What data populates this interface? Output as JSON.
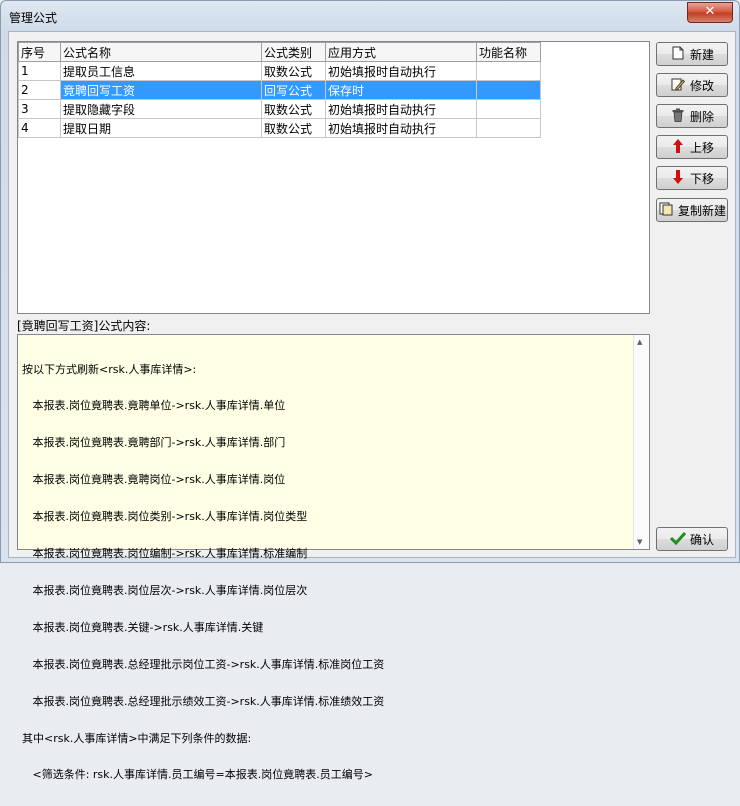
{
  "window": {
    "title": "管理公式",
    "close_label": "✕"
  },
  "grid": {
    "headers": [
      "序号",
      "公式名称",
      "公式类别",
      "应用方式",
      "功能名称"
    ],
    "rows": [
      [
        "1",
        "提取员工信息",
        "取数公式",
        "初始填报时自动执行",
        ""
      ],
      [
        "2",
        "竟聘回写工资",
        "回写公式",
        "保存时",
        ""
      ],
      [
        "3",
        "提取隐藏字段",
        "取数公式",
        "初始填报时自动执行",
        ""
      ],
      [
        "4",
        "提取日期",
        "取数公式",
        "初始填报时自动执行",
        ""
      ]
    ],
    "selected_row": 2
  },
  "content": {
    "label": "[竟聘回写工资]公式内容:",
    "lines": [
      "按以下方式刷新<rsk.人事库详情>:",
      "   本报表.岗位竟聘表.竟聘单位->rsk.人事库详情.单位",
      "   本报表.岗位竟聘表.竟聘部门->rsk.人事库详情.部门",
      "   本报表.岗位竟聘表.竟聘岗位->rsk.人事库详情.岗位",
      "   本报表.岗位竟聘表.岗位类别->rsk.人事库详情.岗位类型",
      "   本报表.岗位竟聘表.岗位编制->rsk.人事库详情.标准编制",
      "   本报表.岗位竟聘表.岗位层次->rsk.人事库详情.岗位层次",
      "   本报表.岗位竟聘表.关键->rsk.人事库详情.关键",
      "   本报表.岗位竟聘表.总经理批示岗位工资->rsk.人事库详情.标准岗位工资",
      "   本报表.岗位竟聘表.总经理批示绩效工资->rsk.人事库详情.标准绩效工资",
      "其中<rsk.人事库详情>中满足下列条件的数据:",
      "   <筛选条件: rsk.人事库详情.员工编号=本报表.岗位竟聘表.员工编号>"
    ]
  },
  "buttons": {
    "new": "新建",
    "edit": "修改",
    "delete": "删除",
    "up": "上移",
    "down": "下移",
    "copy_new": "复制新建",
    "confirm": "确认"
  },
  "icons": {
    "new": "new-document-icon",
    "edit": "edit-icon",
    "delete": "trash-icon",
    "up": "arrow-up-icon",
    "down": "arrow-down-icon",
    "copy_new": "copy-document-icon",
    "confirm": "checkmark-icon"
  },
  "colors": {
    "selection": "#3399ff",
    "text_bg": "#ffffe6",
    "up_arrow": "#d01010",
    "confirm_check": "#1e8f1e"
  }
}
